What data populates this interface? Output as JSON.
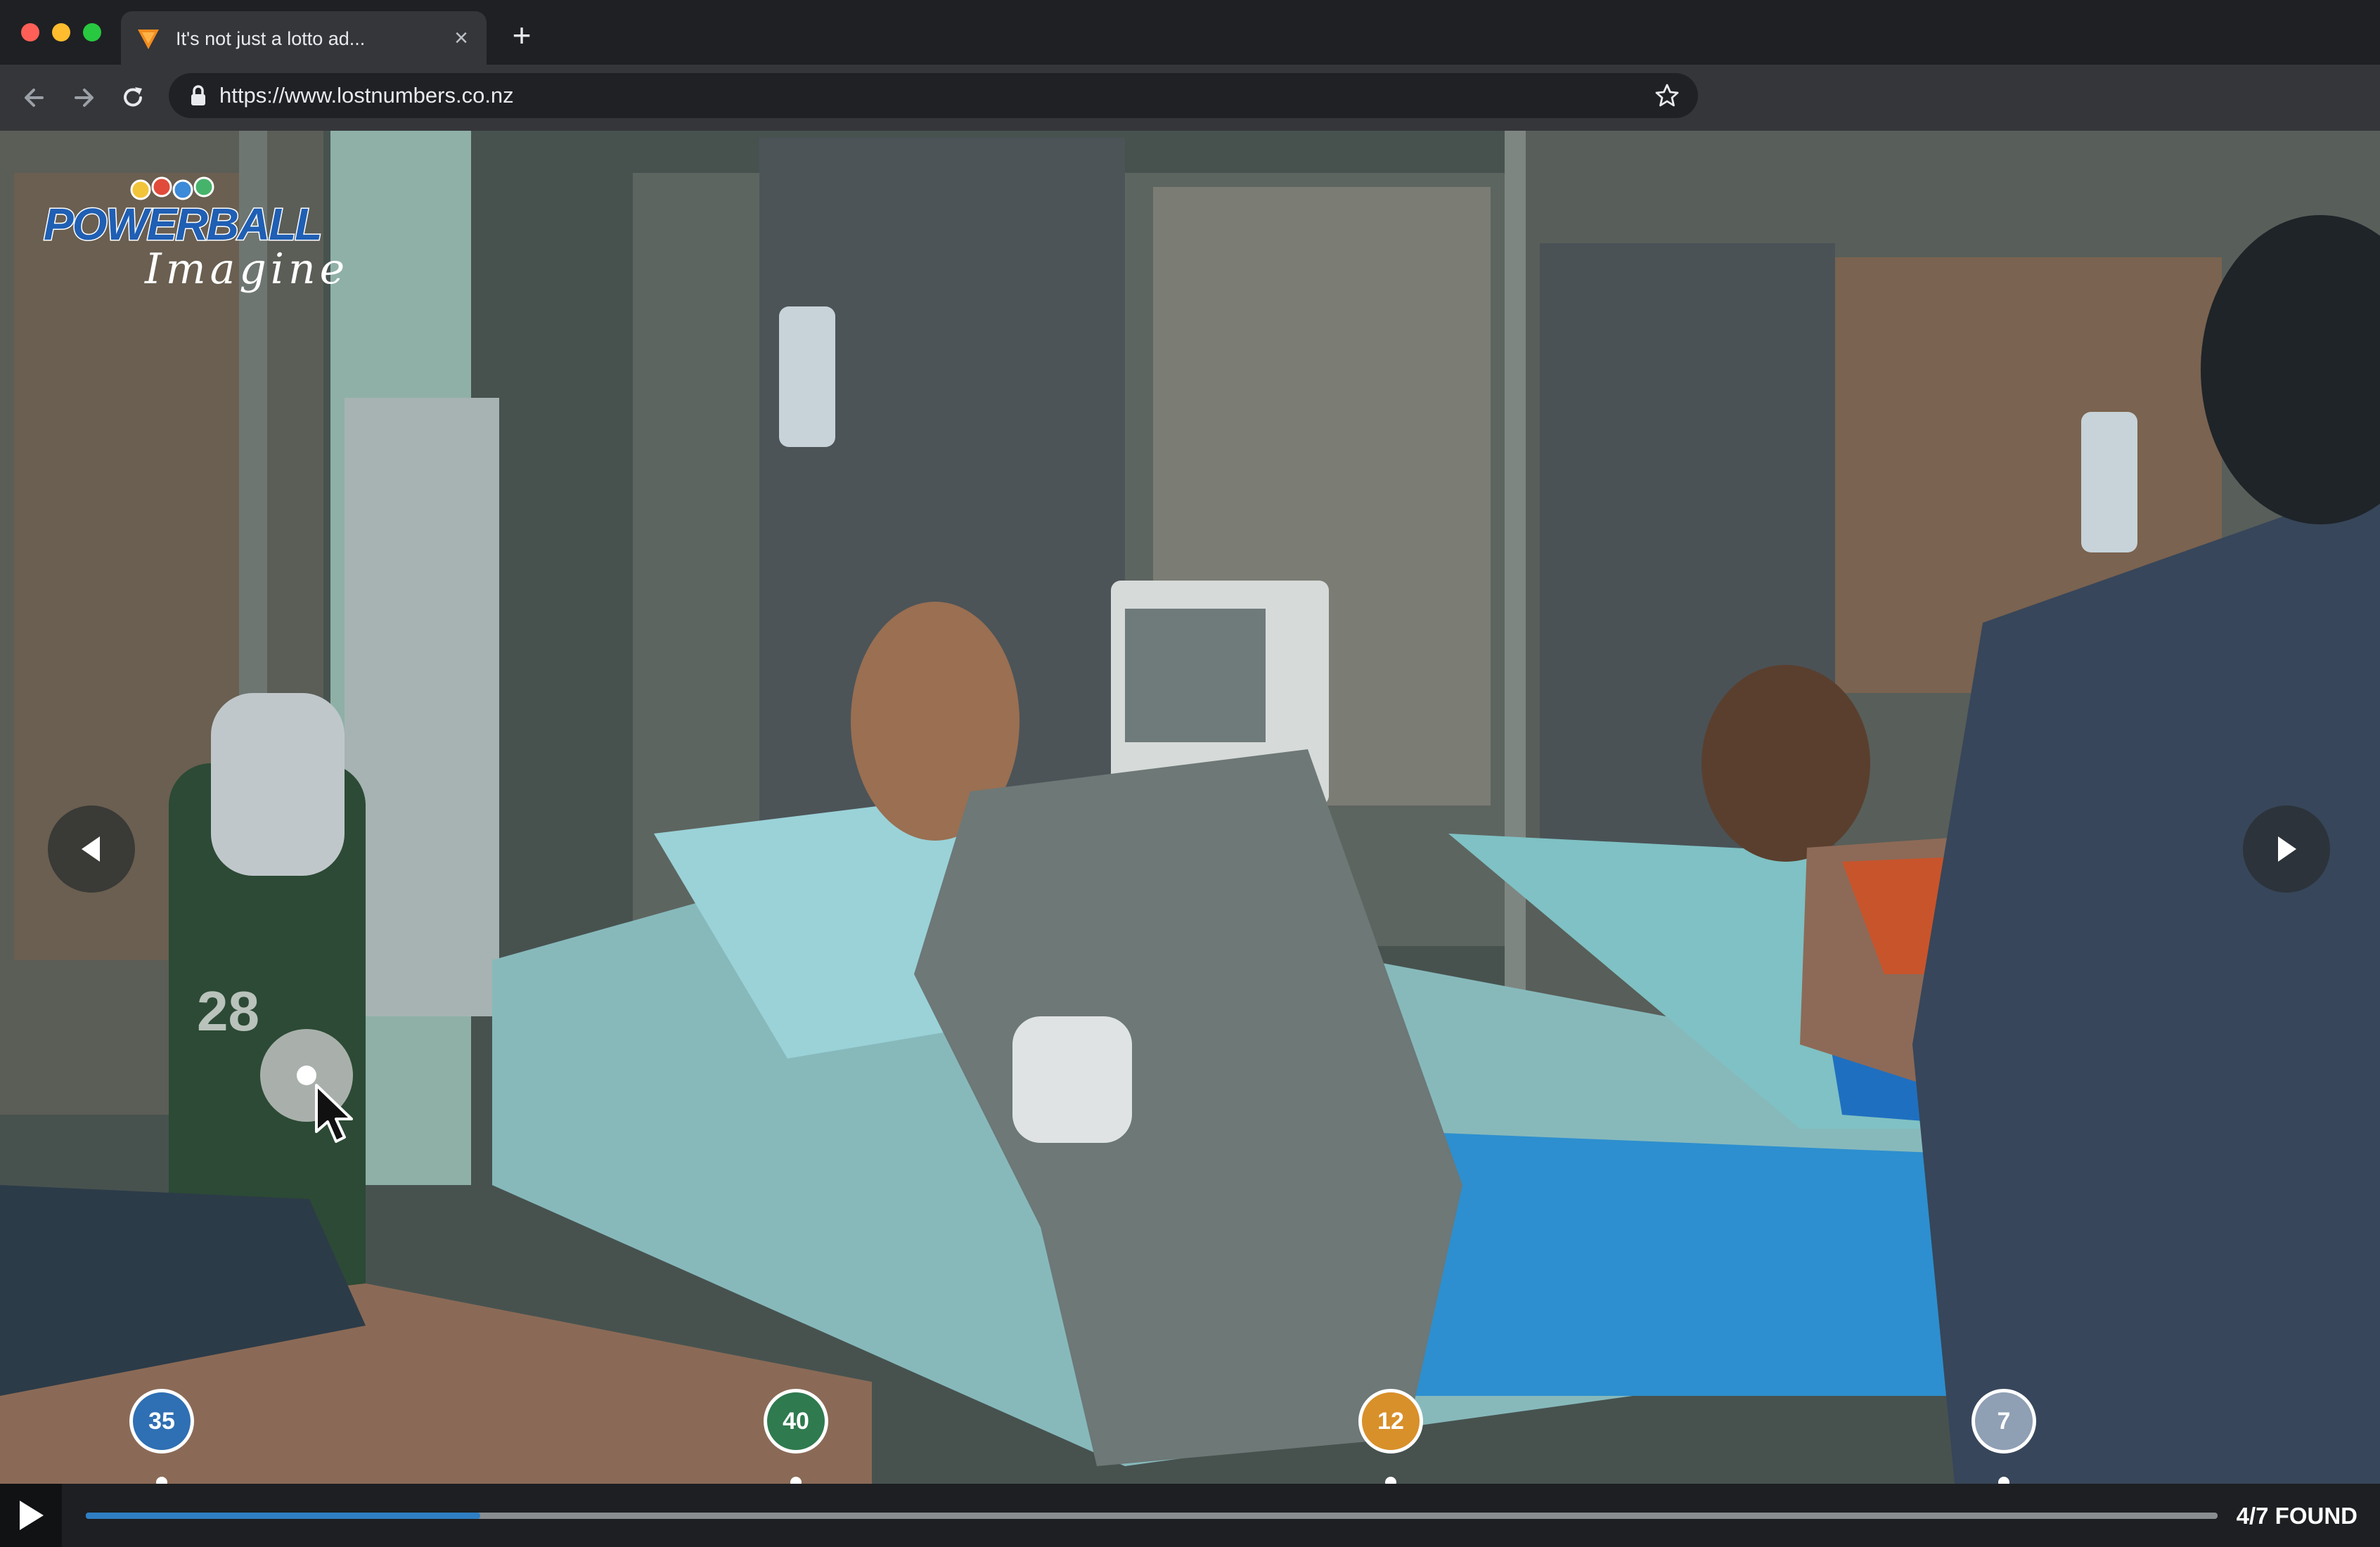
{
  "browser": {
    "tab_title": "It's not just a lotto ad...",
    "tab_close": "×",
    "new_tab": "+",
    "url": "https://www.lostnumbers.co.nz"
  },
  "logo": {
    "brand": "POWERBALL",
    "tagline": "Imagine"
  },
  "markers": [
    {
      "number": "35",
      "color": "#2f6fb3"
    },
    {
      "number": "40",
      "color": "#2f7a4f"
    },
    {
      "number": "12",
      "color": "#d8902a"
    },
    {
      "number": "7",
      "color": "#8f9fb4"
    }
  ],
  "player": {
    "progress": 0.185,
    "found_label": "4/7 FOUND"
  },
  "icons": {
    "play": "play-icon",
    "prev": "chevron-left-icon",
    "next": "chevron-right-icon",
    "hotspot": "hotspot-icon"
  }
}
